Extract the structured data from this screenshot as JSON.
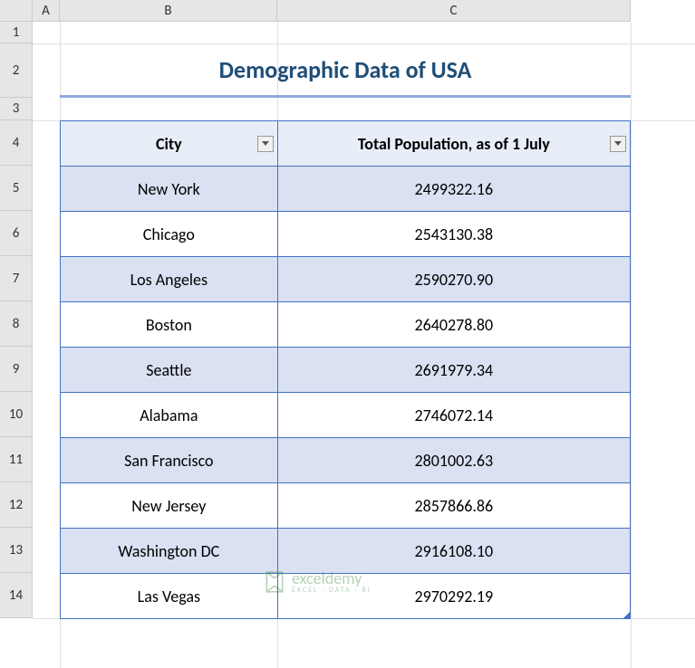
{
  "columns": [
    "A",
    "B",
    "C"
  ],
  "rows": [
    "1",
    "2",
    "3",
    "4",
    "5",
    "6",
    "7",
    "8",
    "9",
    "10",
    "11",
    "12",
    "13",
    "14"
  ],
  "title": "Demographic Data of USA",
  "headers": {
    "city": "City",
    "population": "Total Population, as of 1 July"
  },
  "data": [
    {
      "city": "New York",
      "population": "2499322.16"
    },
    {
      "city": "Chicago",
      "population": "2543130.38"
    },
    {
      "city": "Los Angeles",
      "population": "2590270.90"
    },
    {
      "city": "Boston",
      "population": "2640278.80"
    },
    {
      "city": "Seattle",
      "population": "2691979.34"
    },
    {
      "city": "Alabama",
      "population": "2746072.14"
    },
    {
      "city": "San Francisco",
      "population": "2801002.63"
    },
    {
      "city": "New Jersey",
      "population": "2857866.86"
    },
    {
      "city": "Washington DC",
      "population": "2916108.10"
    },
    {
      "city": "Las Vegas",
      "population": "2970292.19"
    }
  ],
  "watermark": {
    "main": "exceldemy",
    "sub": "EXCEL · DATA · BI"
  }
}
